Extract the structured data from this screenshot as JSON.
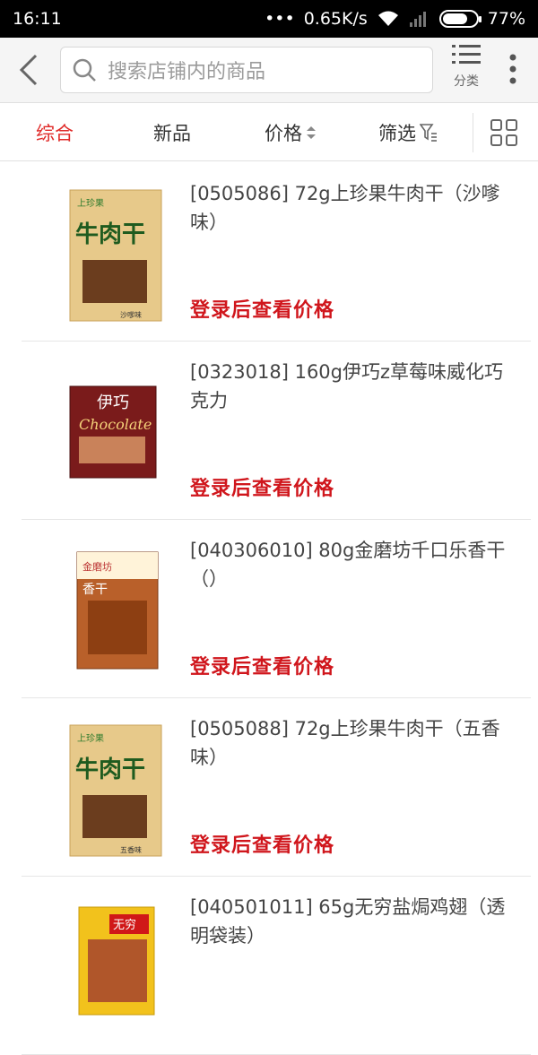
{
  "status": {
    "time": "16:11",
    "speed": "0.65K/s",
    "battery": "77%",
    "battery_level": 0.77
  },
  "header": {
    "search_placeholder": "搜索店铺内的商品",
    "category_label": "分类"
  },
  "sort": {
    "items": [
      {
        "label": "综合",
        "active": true
      },
      {
        "label": "新品"
      },
      {
        "label": "价格"
      },
      {
        "label": "筛选"
      }
    ]
  },
  "products": [
    {
      "name": "[0505086] 72g上珍果牛肉干（沙嗲味）",
      "price": "登录后查看价格",
      "img_brand": "上珍果",
      "img_title": "牛肉干",
      "img_color": "#e7c98a"
    },
    {
      "name": "[0323018] 160g伊巧z草莓味威化巧克力",
      "price": "登录后查看价格",
      "img_brand": "伊巧",
      "img_title": "Chocolate",
      "img_color": "#7a1b1b"
    },
    {
      "name": "[040306010] 80g金磨坊千口乐香干（）",
      "price": "登录后查看价格",
      "img_brand": "金磨坊",
      "img_title": "香干",
      "img_color": "#b9602a"
    },
    {
      "name": "[0505088] 72g上珍果牛肉干（五香味）",
      "price": "登录后查看价格",
      "img_brand": "上珍果",
      "img_title": "牛肉干",
      "img_color": "#e7c98a"
    },
    {
      "name": "[040501011] 65g无穷盐焗鸡翅（透明袋装）",
      "price": "",
      "img_brand": "无穷",
      "img_title": "",
      "img_color": "#f2c21c"
    }
  ]
}
